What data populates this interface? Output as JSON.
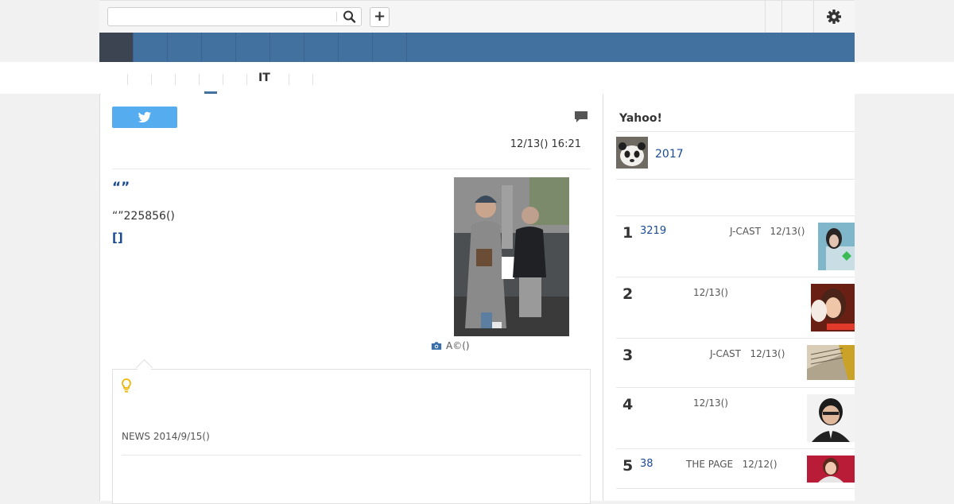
{
  "header": {
    "search_placeholder": "",
    "plus_label": "+"
  },
  "subnav": {
    "items": [
      "IT"
    ]
  },
  "article": {
    "date": "12/13() 16:21",
    "headline": "“”",
    "body": "“”225856()",
    "more": "[]",
    "caption": "A©()"
  },
  "related": {
    "news": "NEWS 2014/9/15()"
  },
  "sidebar": {
    "header": "Yahoo!",
    "feature": "2017",
    "ranking": [
      {
        "num": "1",
        "link": "3219",
        "source": "J-CAST",
        "date": "12/13()"
      },
      {
        "num": "2",
        "link": "",
        "source": "",
        "date": "12/13()"
      },
      {
        "num": "3",
        "link": "",
        "source": "J-CAST",
        "date": "12/13()"
      },
      {
        "num": "4",
        "link": "",
        "source": "",
        "date": "12/13()"
      },
      {
        "num": "5",
        "link": "38",
        "source": "THE PAGE",
        "date": "12/12()"
      }
    ]
  },
  "colors": {
    "nav": "#42709f",
    "nav_active": "#3c4351",
    "link": "#1a4a94",
    "twitter": "#55acee"
  },
  "icons": {
    "search": "search-icon",
    "settings": "gear-icon",
    "comment": "comment-icon",
    "twitter": "twitter-icon",
    "camera": "camera-icon",
    "tip": "lightbulb-icon"
  }
}
